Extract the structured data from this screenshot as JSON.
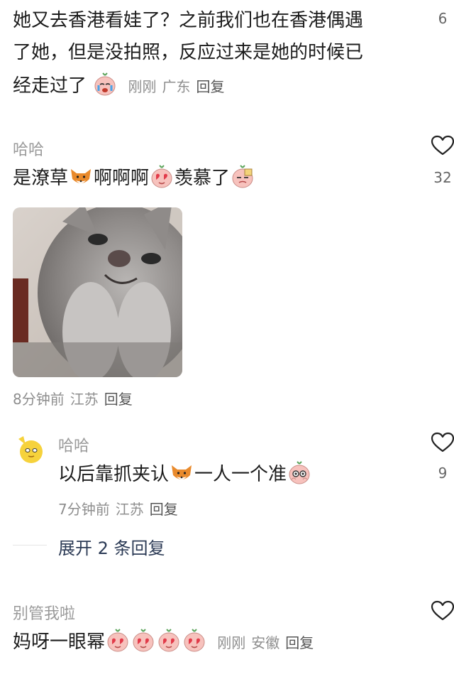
{
  "comment1": {
    "text_line1": "她又去香港看娃了？之前我们也在香港偶遇",
    "text_line2": "了她，但是没拍照，反应过来是她的时候已",
    "text_line3": "经走过了",
    "time": "刚刚",
    "location": "广东",
    "reply": "回复",
    "like_count": "6"
  },
  "comment2": {
    "username": "哈哈",
    "text_a": "是潦草",
    "text_b": "啊啊啊",
    "text_c": "羡慕了",
    "time": "8分钟前",
    "location": "江苏",
    "reply": "回复",
    "like_count": "32"
  },
  "reply1": {
    "username": "哈哈",
    "text_a": "以后靠抓夹认",
    "text_b": "一人一个准",
    "time": "7分钟前",
    "location": "江苏",
    "reply": "回复",
    "like_count": "9"
  },
  "expand_replies": "展开 2 条回复",
  "comment3": {
    "username": "别管我啦",
    "text_a": "妈呀一眼幂",
    "time": "刚刚",
    "location": "安徽",
    "reply": "回复"
  },
  "icons": {
    "like": "heart-outline-icon",
    "emoji_cry": "crying-face-emoji",
    "emoji_fox": "fox-emoji",
    "emoji_love": "heart-eyes-emoji",
    "emoji_envy": "envious-face-emoji",
    "avatar": "yellow-duck-avatar"
  },
  "colors": {
    "text": "#1c1c1c",
    "meta": "#8e8e8e",
    "expand": "#2b3a55"
  }
}
